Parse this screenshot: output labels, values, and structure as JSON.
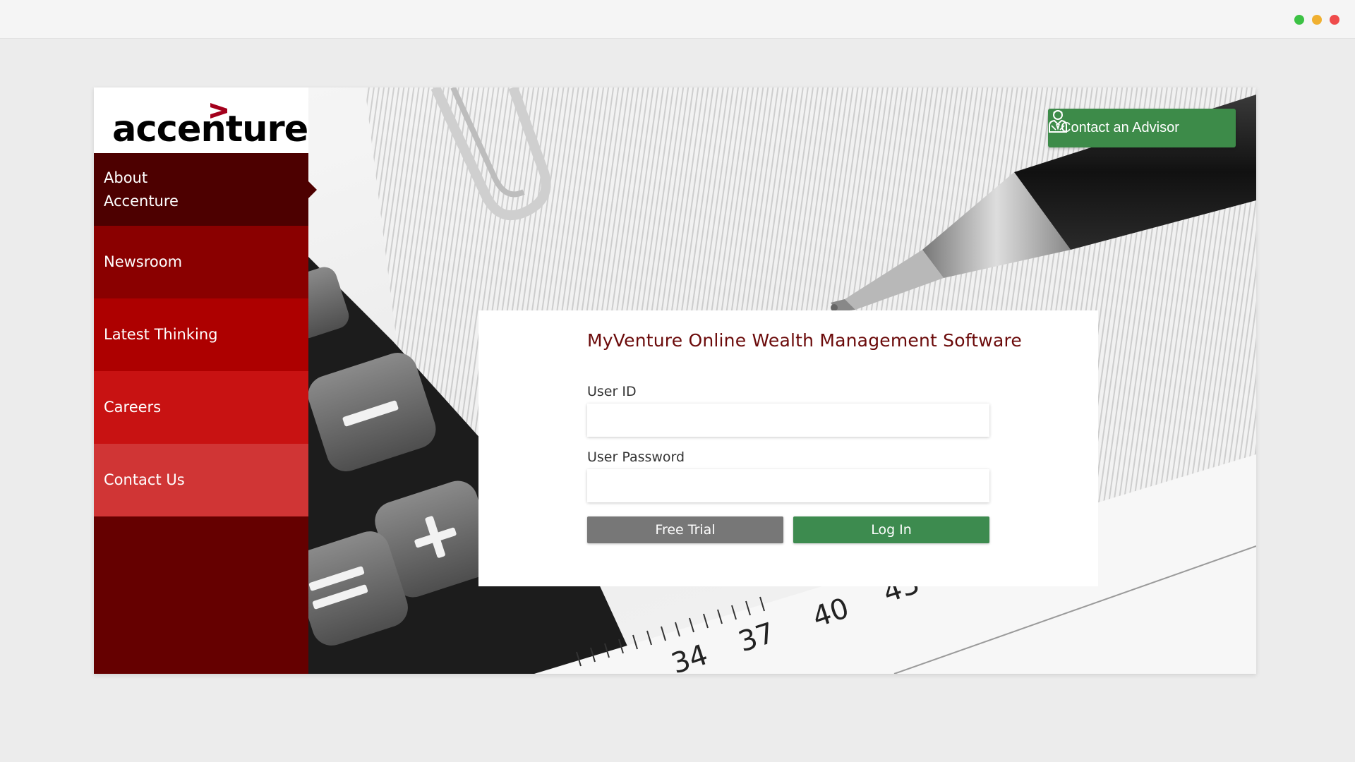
{
  "window": {
    "dots": [
      {
        "name": "green-dot",
        "color": "#3cc244"
      },
      {
        "name": "yellow-dot",
        "color": "#f0b030"
      },
      {
        "name": "red-dot",
        "color": "#ef4b4b"
      }
    ]
  },
  "brand": {
    "logo_text": "accenture",
    "logo_chevron": ">",
    "accent_color": "#a3001c"
  },
  "sidebar": {
    "items": [
      {
        "label": "About\nAccenture",
        "color": "#4d0000",
        "active": true
      },
      {
        "label": "Newsroom",
        "color": "#8a0000"
      },
      {
        "label": "Latest Thinking",
        "color": "#ad0000"
      },
      {
        "label": "Careers",
        "color": "#c81212"
      },
      {
        "label": "Contact Us",
        "color": "#d03535"
      }
    ]
  },
  "header": {
    "advisor_button_label": "Contact an Advisor",
    "advisor_icon": "advisor-person-icon"
  },
  "login": {
    "title": "MyVenture Online Wealth Management Software",
    "user_id_label": "User ID",
    "user_id_value": "",
    "password_label": "User Password",
    "password_value": "",
    "free_trial_label": "Free Trial",
    "login_label": "Log In"
  },
  "photo": {
    "ruler_numbers": [
      "34",
      "37",
      "40",
      "43"
    ],
    "calc_keys": [
      "−",
      "+",
      "="
    ]
  }
}
